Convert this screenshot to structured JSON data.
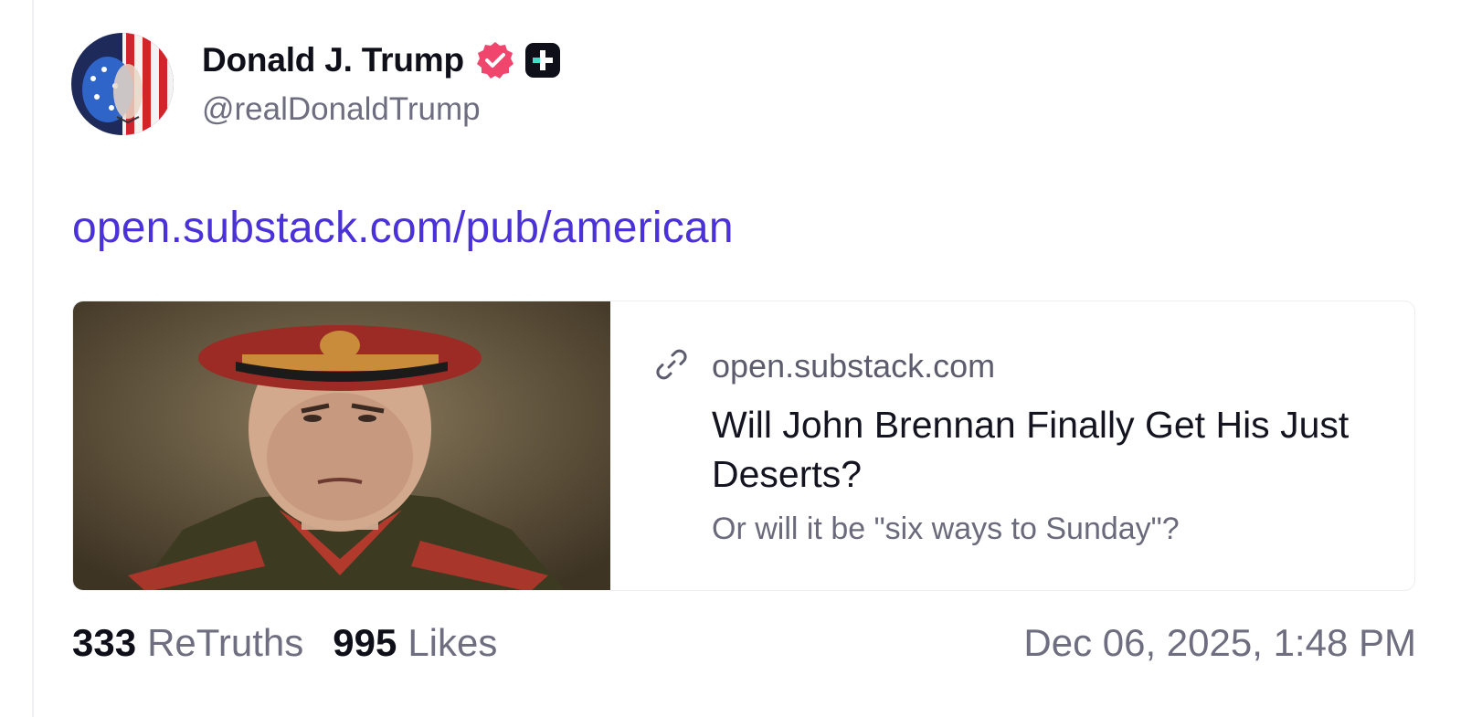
{
  "author": {
    "display_name": "Donald J. Trump",
    "handle": "@realDonaldTrump",
    "verified_icon": "verified-badge-icon",
    "verified_color": "#f0466e",
    "plus_badge_icon": "truth-plus-icon"
  },
  "post": {
    "link_text": "open.substack.com/pub/american",
    "link_color": "#4a32d8"
  },
  "card": {
    "domain": "open.substack.com",
    "title": "Will John Brennan Finally Get His Just Deserts?",
    "subtitle": "Or will it be \"six ways to Sunday\"?",
    "link_icon": "link-icon"
  },
  "stats": {
    "retruths_count": "333",
    "retruths_label": "ReTruths",
    "likes_count": "995",
    "likes_label": "Likes"
  },
  "timestamp": "Dec 06, 2025, 1:48 PM"
}
